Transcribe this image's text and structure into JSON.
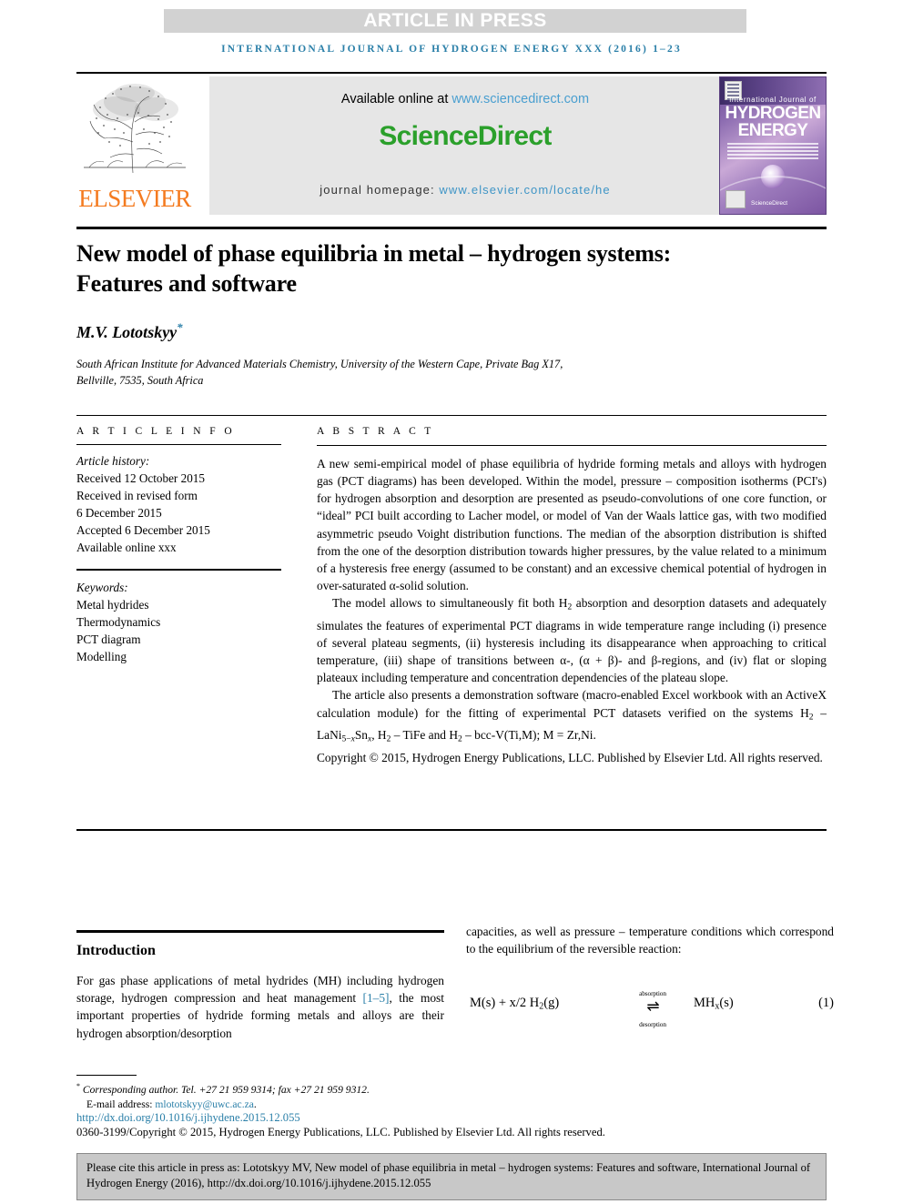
{
  "banner": {
    "text": "ARTICLE IN PRESS"
  },
  "running_head": "INTERNATIONAL JOURNAL OF HYDROGEN ENERGY XXX (2016) 1–23",
  "masthead": {
    "publisher": "ELSEVIER",
    "available_prefix": "Available online at ",
    "available_url": "www.sciencedirect.com",
    "sciencedirect": "ScienceDirect",
    "homepage_label": "journal homepage: ",
    "homepage_url": "www.elsevier.com/locate/he",
    "cover": {
      "line_top": "International Journal of",
      "line_hydrogen": "HYDROGEN",
      "line_energy": "ENERGY",
      "sciencedirect_mark": "ScienceDirect"
    }
  },
  "article": {
    "title": "New model of phase equilibria in metal – hydrogen systems: Features and software",
    "author": "M.V. Lototskyy",
    "author_marker": "*",
    "affiliation_line1": "South African Institute for Advanced Materials Chemistry, University of the Western Cape, Private Bag X17,",
    "affiliation_line2": "Bellville, 7535, South Africa"
  },
  "article_info": {
    "heading": "A R T I C L E   I N F O",
    "history_label": "Article history:",
    "history": [
      "Received 12 October 2015",
      "Received in revised form",
      "6 December 2015",
      "Accepted 6 December 2015",
      "Available online xxx"
    ],
    "keywords_label": "Keywords:",
    "keywords": [
      "Metal hydrides",
      "Thermodynamics",
      "PCT diagram",
      "Modelling"
    ]
  },
  "abstract": {
    "heading": "A B S T R A C T",
    "para1_a": "A new semi-empirical model of phase equilibria of hydride forming metals and alloys with hydrogen gas (PCT diagrams) has been developed. Within the model, pressure – composition isotherms (PCI's) for hydrogen absorption and desorption are presented as pseudo-convolutions of one core function, or “ideal” PCI built according to Lacher model, or model of Van der Waals lattice gas, with two modified asymmetric pseudo Voight distribution functions. The median of the absorption distribution is shifted from the one of the desorption distribution towards higher pressures, by the value related to a minimum of a hysteresis free energy (assumed to be constant) and an excessive chemical potential of hydrogen in over-saturated α-solid solution.",
    "para2_a": "The model allows to simultaneously fit both H",
    "para2_sub": "2",
    "para2_b": " absorption and desorption datasets and adequately simulates the features of experimental PCT diagrams in wide temperature range including (i) presence of several plateau segments, (ii) hysteresis including its disappearance when approaching to critical temperature, (iii) shape of transitions between α-, (α + β)- and β-regions, and (iv) flat or sloping plateaux including temperature and concentration dependencies of the plateau slope.",
    "para3_a": "The article also presents a demonstration software (macro-enabled Excel workbook with an ActiveX calculation module) for the fitting of experimental PCT datasets verified on the systems H",
    "para3_formula": "2 – LaNi5−xSnx, H2 – TiFe and H2 – bcc-V(Ti,M); M = Zr,Ni.",
    "copyright": "Copyright © 2015, Hydrogen Energy Publications, LLC. Published by Elsevier Ltd. All rights reserved."
  },
  "body": {
    "intro_heading": "Introduction",
    "left_para_a": "For gas phase applications of metal hydrides (MH) including hydrogen storage, hydrogen compression and heat management ",
    "left_ref": "[1–5]",
    "left_para_b": ", the most important properties of hydride forming metals and alloys are their hydrogen absorption/desorption",
    "right_para": "capacities, as well as pressure – temperature conditions which correspond to the equilibrium of the reversible reaction:",
    "equation": {
      "lhs": "M(s) + x/2 H",
      "lhs_sub": "2",
      "lhs_tail": "(g)",
      "above": "absorption",
      "arrow": "⇌",
      "below": "desorption",
      "rhs": "MH",
      "rhs_sub": "x",
      "rhs_tail": "(s)",
      "number": "(1)"
    }
  },
  "footnote": {
    "marker": "*",
    "corresponding": "Corresponding author. Tel. +27 21 959 9314; fax +27 21 959 9312.",
    "email_label": "E-mail address: ",
    "email": "mlototskyy@uwc.ac.za",
    "email_tail": ".",
    "doi": "http://dx.doi.org/10.1016/j.ijhydene.2015.12.055",
    "copyright": "0360-3199/Copyright © 2015, Hydrogen Energy Publications, LLC. Published by Elsevier Ltd. All rights reserved."
  },
  "cite_box": {
    "text": "Please cite this article in press as: Lototskyy MV, New model of phase equilibria in metal – hydrogen systems: Features and software, International Journal of Hydrogen Energy (2016), http://dx.doi.org/10.1016/j.ijhydene.2015.12.055"
  },
  "colors": {
    "link_blue": "#2a7fa8",
    "sciencedirect_green": "#2ba02b",
    "elsevier_orange": "#f47b20",
    "banner_gray": "#d2d2d2",
    "cite_gray": "#c8c8c8"
  }
}
